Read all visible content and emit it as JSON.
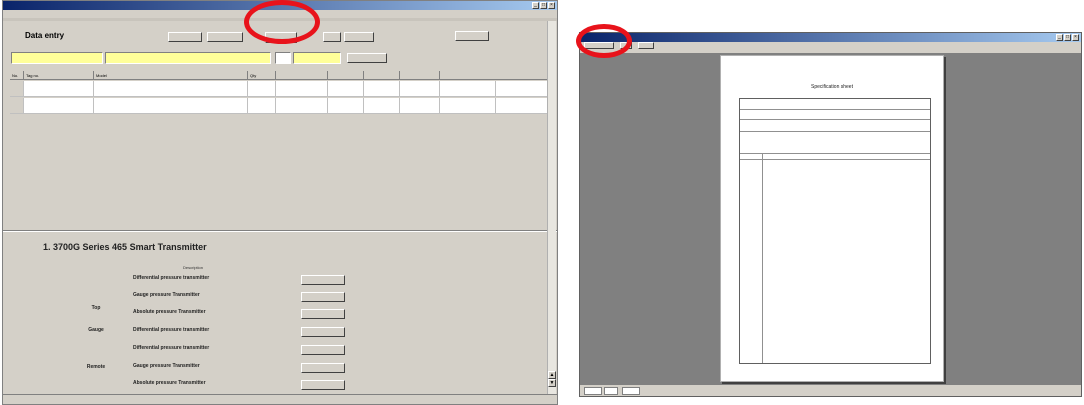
{
  "left_window": {
    "title": "",
    "menu": [
      "",
      "",
      "",
      "",
      "",
      ""
    ],
    "data_entry": {
      "title": "Data entry",
      "buttons": {
        "blank": "",
        "print": "",
        "load": "",
        "browse": ""
      }
    },
    "grid": {
      "columns": [
        "No.",
        "Tag no.",
        "Model",
        "Qty",
        "",
        "",
        "",
        "",
        ""
      ],
      "rows": 2
    },
    "product_title": "1. 3700G Series 465 Smart Transmitter",
    "model_table": {
      "headers": {
        "group": "",
        "description": "Description",
        "button": ""
      },
      "groups": [
        "Top",
        "Gauge",
        "Remote"
      ],
      "descriptions": [
        "Differential pressure transmitter",
        "Gauge pressure Transmitter",
        "Absolute pressure Transmitter",
        "Differential pressure transmitter",
        "Differential pressure transmitter",
        "Gauge pressure Transmitter",
        "Absolute pressure Transmitter"
      ]
    }
  },
  "right_window": {
    "title": "",
    "sheet": {
      "title": "Specification sheet",
      "footer": ""
    }
  },
  "colors": {
    "annotation": "#e8131b",
    "titlebar": "#0a246a",
    "window_face": "#d4d0c8",
    "preview_bg": "#808080"
  }
}
